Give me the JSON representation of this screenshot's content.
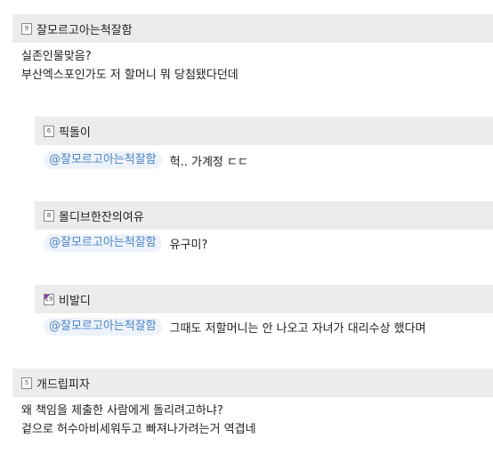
{
  "comments": [
    {
      "nick": "잘모르고아는척잘함",
      "level": "9",
      "lines": [
        "실존인물맞음?",
        "부산엑스포인가도 저 할머니 뭐 당첨됐다던데"
      ]
    },
    {
      "nick": "픽돌이",
      "level": "6",
      "mention": "@잘모르고아는척잘함",
      "text": "헉.. 가계정 ㄷㄷ"
    },
    {
      "nick": "몰디브한잔의여유",
      "level": "8",
      "mention": "@잘모르고아는척잘함",
      "text": "유구미?"
    },
    {
      "nick": "비발디",
      "level": "19",
      "mention": "@잘모르고아는척잘함",
      "text": "그때도 저할머니는 안 나오고 자녀가 대리수상 했다며"
    },
    {
      "nick": "개드립피자",
      "level": "5",
      "lines": [
        "왜 책임을 제출한 사람에게 돌리려고하냐?",
        "겉으로 허수아비세워두고 빠져나가려는거 역겹네"
      ]
    }
  ],
  "colors": {
    "header_bg": "#ececec",
    "mention_text": "#4a84c7",
    "mention_bg": "#eef3fb",
    "level_badge_accent": "#7a3fb0"
  }
}
